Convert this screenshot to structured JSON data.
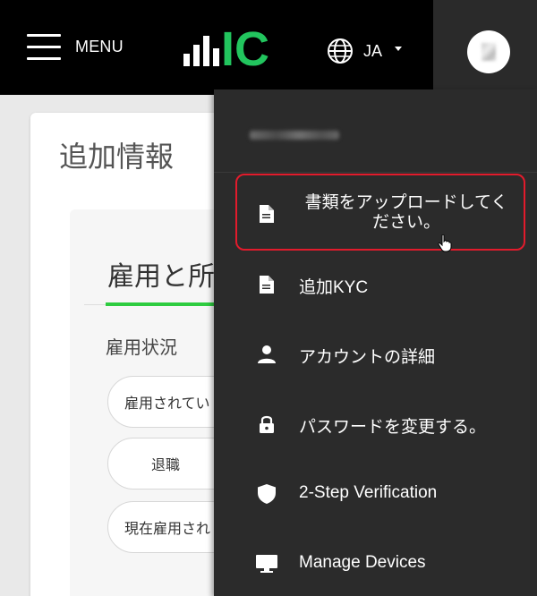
{
  "header": {
    "menu_label": "MENU",
    "logo_text": "IC",
    "language": "JA",
    "colors": {
      "background": "#000000",
      "logo_green": "#22c55e"
    }
  },
  "page": {
    "title": "追加情報",
    "section_title": "雇用と所",
    "field_label": "雇用状況",
    "options": [
      "雇用されてい",
      "退職",
      "現在雇用され"
    ]
  },
  "dropdown": {
    "items": [
      {
        "label": "書類をアップロードしてください。",
        "icon": "document-icon"
      },
      {
        "label": "追加KYC",
        "icon": "document-icon"
      },
      {
        "label": "アカウントの詳細",
        "icon": "user-icon"
      },
      {
        "label": "パスワードを変更する。",
        "icon": "lock-icon"
      },
      {
        "label": "2-Step Verification",
        "icon": "shield-icon"
      },
      {
        "label": "Manage Devices",
        "icon": "monitor-icon"
      }
    ],
    "colors": {
      "background": "#2b2b2b",
      "highlight": "#e21b2c"
    }
  }
}
